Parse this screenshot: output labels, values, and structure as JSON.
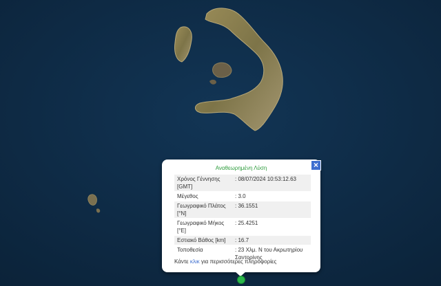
{
  "popup": {
    "title": "Αναθεωρημένη Λύση",
    "close_label": "×",
    "rows": [
      {
        "label": "Χρόνος Γέννησης [GMT]",
        "value": ": 08/07/2024 10:53:12.63"
      },
      {
        "label": "Μέγεθος",
        "value": ": 3.0"
      },
      {
        "label": "Γεωγραφικό Πλάτος [°N]",
        "value": ": 36.1551"
      },
      {
        "label": "Γεωγραφικό Μήκος [°E]",
        "value": ": 25.4251"
      },
      {
        "label": "Εστιακό Βάθος [km]",
        "value": ": 16.7"
      },
      {
        "label": "Τοποθεσία",
        "value": ": 23 Χλμ. N του Ακρωτηρίου Σαντορίνης"
      }
    ],
    "more_prefix": "Κάντε ",
    "more_link": "κλικ",
    "more_suffix": " για περισσότερες πληροφορίες"
  },
  "colors": {
    "sea": "#0d2a44",
    "land": "#8a8050",
    "title": "#2d9c3c",
    "link": "#3f6fcf",
    "marker": "#2bb84a"
  }
}
